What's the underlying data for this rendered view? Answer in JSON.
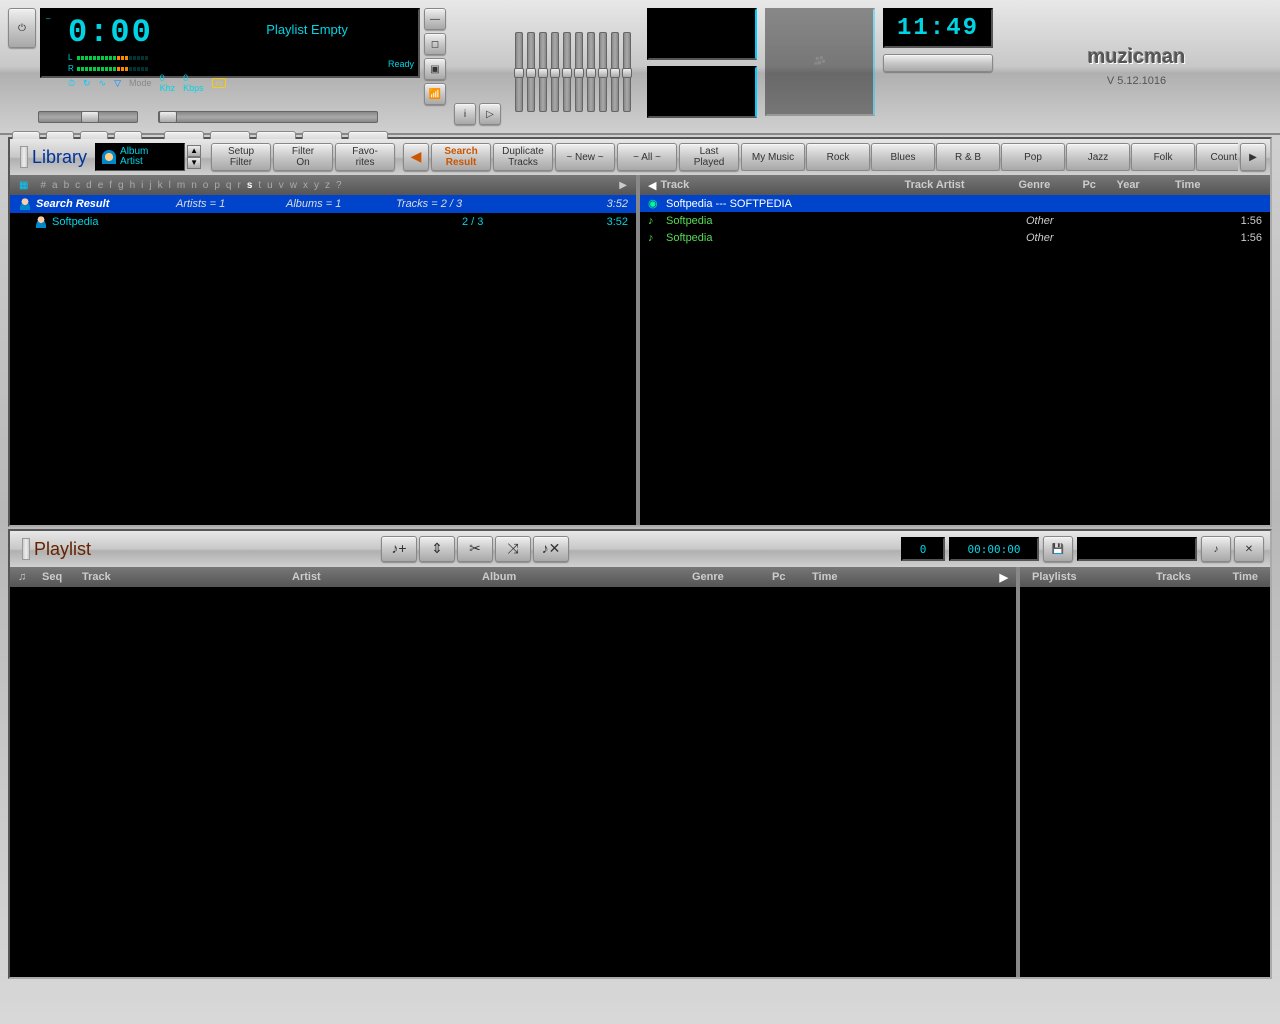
{
  "player": {
    "time": "0:00",
    "playlist_status": "Playlist Empty",
    "mode_label": "Mode",
    "khz": "0 Khz",
    "kbps": "0 Kbps",
    "ready": "Ready",
    "vu_l": "L",
    "vu_r": "R",
    "clock": "11:49"
  },
  "brand": {
    "name": "muzicman",
    "version": "V 5.12.1016"
  },
  "library": {
    "title": "Library",
    "view_mode_l1": "Album",
    "view_mode_l2": "Artist",
    "btns": {
      "setup_filter_l1": "Setup",
      "setup_filter_l2": "Filter",
      "filter_on_l1": "Filter",
      "filter_on_l2": "On",
      "favorites_l1": "Favo-",
      "favorites_l2": "rites",
      "search_l1": "Search",
      "search_l2": "Result",
      "dup_l1": "Duplicate",
      "dup_l2": "Tracks",
      "new": "~ New ~",
      "all": "~ All ~",
      "last_l1": "Last",
      "last_l2": "Played"
    },
    "genre_tabs": [
      "My Music",
      "Rock",
      "Blues",
      "R & B",
      "Pop",
      "Jazz",
      "Folk",
      "Country"
    ],
    "alpha": [
      "#",
      "a",
      "b",
      "c",
      "d",
      "e",
      "f",
      "g",
      "h",
      "i",
      "j",
      "k",
      "l",
      "m",
      "n",
      "o",
      "p",
      "q",
      "r",
      "s",
      "t",
      "u",
      "v",
      "w",
      "x",
      "y",
      "z",
      "?"
    ],
    "alpha_active": "s",
    "tree_header": {
      "name": "Search Result",
      "artists": "Artists = 1",
      "albums": "Albums = 1",
      "tracks": "Tracks = 2 / 3",
      "dur": "3:52"
    },
    "tree_rows": [
      {
        "name": "Softpedia",
        "count": "2 / 3",
        "dur": "3:52"
      }
    ],
    "track_cols": {
      "track": "Track",
      "artist": "Track Artist",
      "genre": "Genre",
      "pc": "Pc",
      "year": "Year",
      "time": "Time"
    },
    "tracks": [
      {
        "name": "Softpedia --- SOFTPEDIA",
        "genre": "",
        "time": "",
        "selected": true
      },
      {
        "name": "Softpedia",
        "genre": "Other",
        "time": "1:56",
        "selected": false
      },
      {
        "name": "Softpedia",
        "genre": "Other",
        "time": "1:56",
        "selected": false
      }
    ]
  },
  "playlist": {
    "title": "Playlist",
    "count": "0",
    "duration": "00:00:00",
    "cols": {
      "seq": "Seq",
      "track": "Track",
      "artist": "Artist",
      "album": "Album",
      "genre": "Genre",
      "pc": "Pc",
      "time": "Time"
    },
    "side_cols": {
      "playlists": "Playlists",
      "tracks": "Tracks",
      "time": "Time"
    }
  }
}
